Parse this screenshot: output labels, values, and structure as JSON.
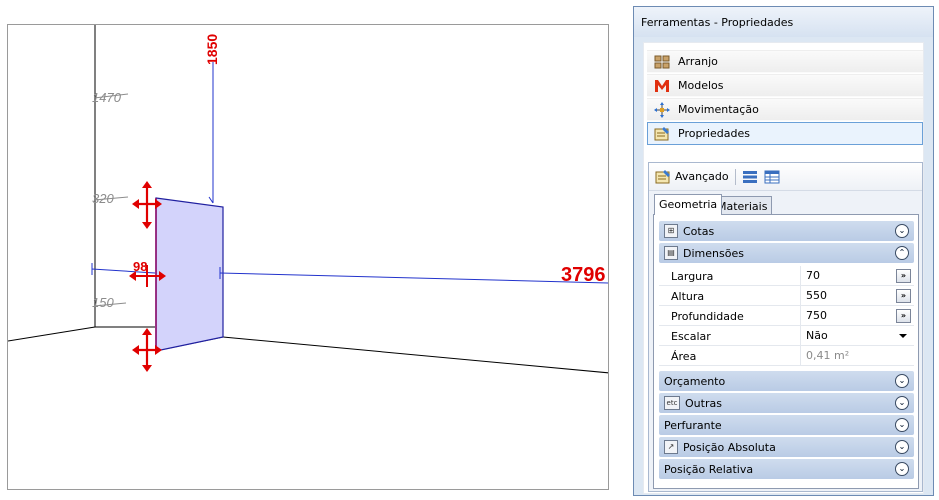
{
  "viewport": {
    "dimensions": {
      "d1470": "1470",
      "d1850": "1850",
      "d320": "320",
      "d98": "98",
      "d150": "150",
      "d3796": "3796"
    }
  },
  "panel": {
    "title": "Ferramentas - Propriedades",
    "nav": [
      {
        "label": "Arranjo",
        "icon": "grid-icon"
      },
      {
        "label": "Modelos",
        "icon": "modelos-m-icon"
      },
      {
        "label": "Movimentação",
        "icon": "move-arrows-icon"
      },
      {
        "label": "Propriedades",
        "icon": "properties-icon"
      }
    ],
    "advanced": {
      "label": "Avançado",
      "tabs": [
        "Geometria",
        "Materiais"
      ],
      "sections": {
        "cotas": "Cotas",
        "dimensoes": "Dimensões",
        "orcamento": "Orçamento",
        "outras": "Outras",
        "outras_icon_text": "etc",
        "perfurante": "Perfurante",
        "posicao_absoluta": "Posição Absoluta",
        "posicao_relativa": "Posição Relativa"
      },
      "properties": [
        {
          "name": "Largura",
          "value": "70"
        },
        {
          "name": "Altura",
          "value": "550"
        },
        {
          "name": "Profundidade",
          "value": "750"
        },
        {
          "name": "Escalar",
          "value": "Não"
        },
        {
          "name": "Área",
          "value": "0,41 m²"
        }
      ],
      "ellipsis": "»"
    }
  },
  "colors": {
    "panel_bg": "#dce7f3",
    "section_bg": "#b9cbe5",
    "dimension_red": "#e00000",
    "dimension_blue": "#2233cc",
    "object_fill": "#d0d0fa"
  }
}
